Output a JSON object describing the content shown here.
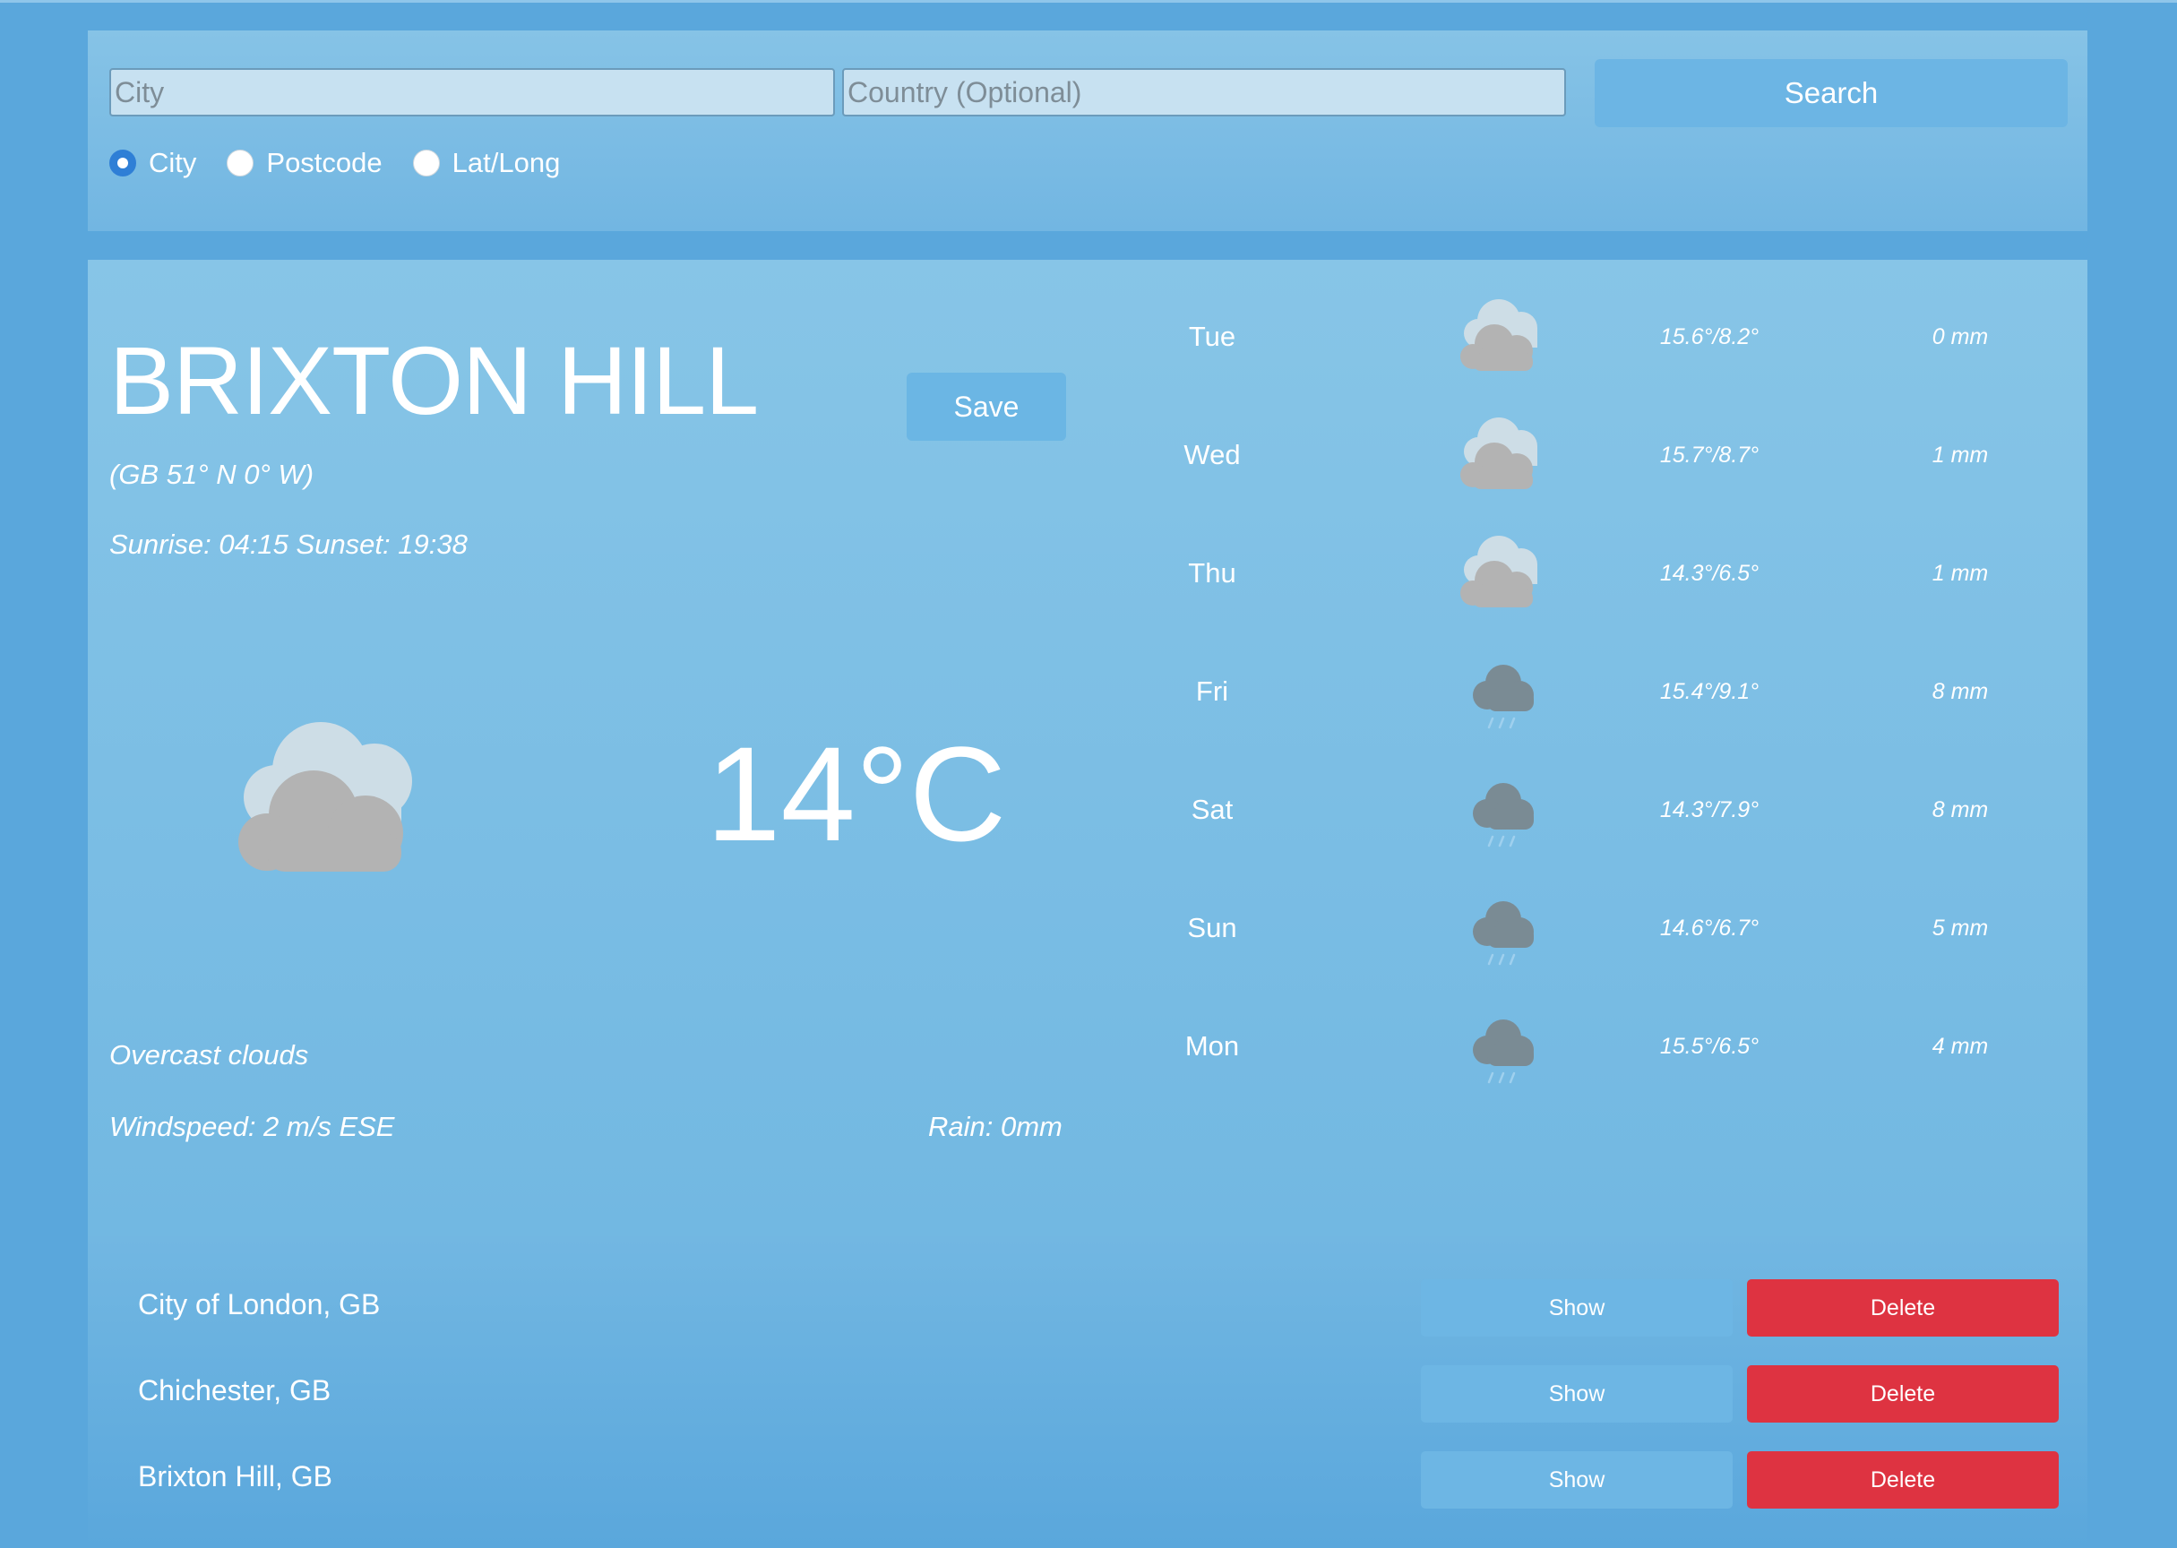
{
  "search": {
    "city_placeholder": "City",
    "country_placeholder": "Country (Optional)",
    "button_label": "Search",
    "modes": [
      {
        "label": "City",
        "selected": true
      },
      {
        "label": "Postcode",
        "selected": false
      },
      {
        "label": "Lat/Long",
        "selected": false
      }
    ]
  },
  "current": {
    "location": "BRIXTON HILL",
    "save_label": "Save",
    "coordinates": "(GB 51° N 0° W)",
    "sun_times": "Sunrise: 04:15 Sunset: 19:38",
    "temperature": "14°C",
    "icon": "overcast-clouds-icon",
    "description": "Overcast clouds",
    "wind": "Windspeed: 2 m/s ESE",
    "rain": "Rain: 0mm"
  },
  "forecast": [
    {
      "day": "Tue",
      "icon": "cloudy-icon",
      "temps": "15.6°/8.2°",
      "rain": "0 mm"
    },
    {
      "day": "Wed",
      "icon": "cloudy-icon",
      "temps": "15.7°/8.7°",
      "rain": "1 mm"
    },
    {
      "day": "Thu",
      "icon": "cloudy-icon",
      "temps": "14.3°/6.5°",
      "rain": "1 mm"
    },
    {
      "day": "Fri",
      "icon": "rain-icon",
      "temps": "15.4°/9.1°",
      "rain": "8 mm"
    },
    {
      "day": "Sat",
      "icon": "rain-icon",
      "temps": "14.3°/7.9°",
      "rain": "8 mm"
    },
    {
      "day": "Sun",
      "icon": "rain-icon",
      "temps": "14.6°/6.7°",
      "rain": "5 mm"
    },
    {
      "day": "Mon",
      "icon": "rain-icon",
      "temps": "15.5°/6.5°",
      "rain": "4 mm"
    }
  ],
  "saved": [
    {
      "name": "City of London, GB",
      "show_label": "Show",
      "delete_label": "Delete"
    },
    {
      "name": "Chichester, GB",
      "show_label": "Show",
      "delete_label": "Delete"
    },
    {
      "name": "Brixton Hill, GB",
      "show_label": "Show",
      "delete_label": "Delete"
    }
  ],
  "colors": {
    "background": "#5aa7dc",
    "panel": "#7dbde4",
    "button": "#6cb5e4",
    "delete": "#de3341",
    "radio_selected": "#2f7fd6"
  }
}
